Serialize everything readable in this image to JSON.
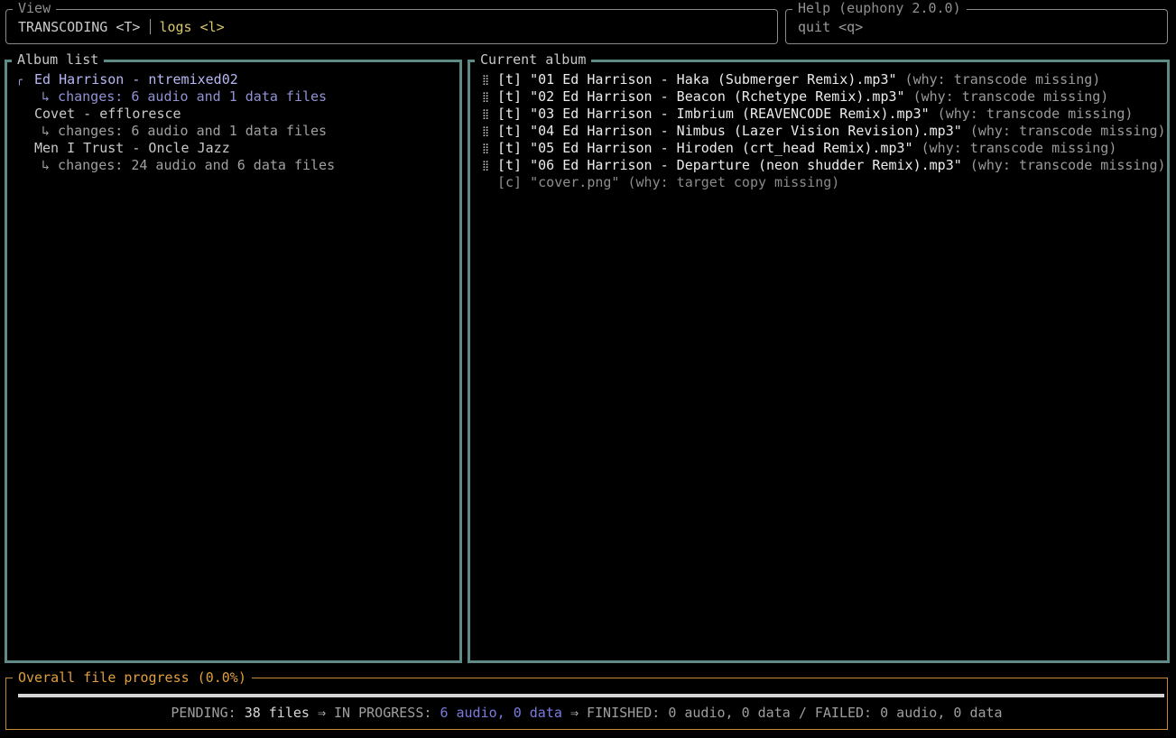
{
  "view": {
    "title": "View",
    "tabs": [
      {
        "label": "TRANSCODING <T>",
        "active": true
      },
      {
        "label": "logs <l>",
        "active": false
      }
    ]
  },
  "help": {
    "title": "Help (euphony 2.0.0)",
    "text": "quit <q>"
  },
  "album_list": {
    "title": "Album list",
    "cursor_icon": "cursor-icon",
    "items": [
      {
        "name": "Ed Harrison - ntremixed02",
        "changes": "↳ changes: 6 audio and 1 data files",
        "selected": true
      },
      {
        "name": "Covet - effloresce",
        "changes": "↳ changes: 6 audio and 1 data files",
        "selected": false
      },
      {
        "name": "Men I Trust - Oncle Jazz",
        "changes": "↳ changes: 24 audio and 6 data files",
        "selected": false
      }
    ]
  },
  "current_album": {
    "title": "Current album",
    "files": [
      {
        "type": "[t]",
        "name": "\"01 Ed Harrison - Haka (Submerger Remix).mp3\"",
        "why": "(why: transcode missing)",
        "in_progress": true
      },
      {
        "type": "[t]",
        "name": "\"02 Ed Harrison - Beacon (Rchetype Remix).mp3\"",
        "why": "(why: transcode missing)",
        "in_progress": true
      },
      {
        "type": "[t]",
        "name": "\"03 Ed Harrison - Imbrium (REAVENCODE Remix).mp3\"",
        "why": "(why: transcode missing)",
        "in_progress": true
      },
      {
        "type": "[t]",
        "name": "\"04 Ed Harrison - Nimbus (Lazer Vision Revision).mp3\"",
        "why": "(why: transcode missing)",
        "in_progress": true
      },
      {
        "type": "[t]",
        "name": "\"05 Ed Harrison - Hiroden (crt_head Remix).mp3\"",
        "why": "(why: transcode missing)",
        "in_progress": true
      },
      {
        "type": "[t]",
        "name": "\"06 Ed Harrison - Departure (neon shudder Remix).mp3\"",
        "why": "(why: transcode missing)",
        "in_progress": true
      },
      {
        "type": "[c]",
        "name": "\"cover.png\"",
        "why": "(why: target copy missing)",
        "in_progress": false
      }
    ]
  },
  "progress": {
    "title": "Overall file progress (0.0%)",
    "fill_fraction": 1.0,
    "pending_label": "PENDING:",
    "pending_value": "38 files",
    "in_progress_label": "IN PROGRESS:",
    "in_progress_audio": "6 audio,",
    "in_progress_data": "0 data",
    "finished_label": "FINISHED:",
    "finished_value": "0 audio, 0 data",
    "failed_label": "/ FAILED:",
    "failed_value": "0 audio, 0 data",
    "arrow": "⇒"
  },
  "colors": {
    "panel_border": "#5f8b87",
    "progress_border": "#c68c3c",
    "selected_album": "#b7b7f5",
    "accent_in_progress": "#7b7bdf",
    "inactive_tab": "#d8c96a"
  }
}
